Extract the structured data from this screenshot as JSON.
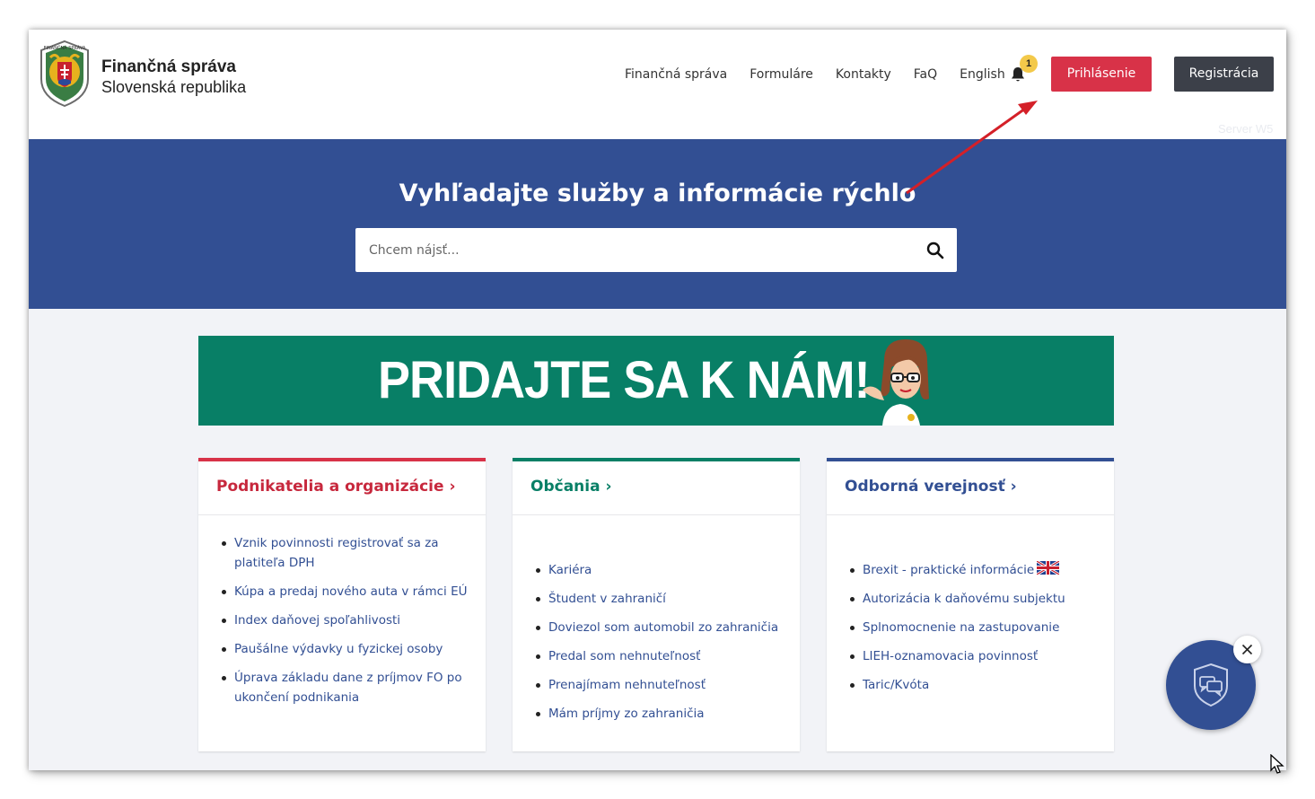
{
  "header": {
    "brand_line1": "Finančná správa",
    "brand_line2": "Slovenská republika",
    "nav": [
      {
        "label": "Finančná správa"
      },
      {
        "label": "Formuláre"
      },
      {
        "label": "Kontakty"
      },
      {
        "label": "FaQ"
      },
      {
        "label": "English"
      }
    ],
    "notifications_count": "1",
    "login_label": "Prihlásenie",
    "register_label": "Registrácia",
    "server_label": "Server W5"
  },
  "hero": {
    "title": "Vyhľadajte služby a informácie rýchlo",
    "search_placeholder": "Chcem nájsť..."
  },
  "banner": {
    "text": "PRIDAJTE SA K NÁM!"
  },
  "cards": [
    {
      "title": "Podnikatelia a organizácie ›",
      "color": "#d83248",
      "items": [
        "Vznik povinnosti registrovať sa za platiteľa DPH",
        "Kúpa a predaj nového auta v rámci EÚ",
        "Index daňovej spoľahlivosti",
        "Paušálne výdavky u fyzickej osoby",
        "Úprava základu dane z príjmov FO po ukončení podnikania"
      ]
    },
    {
      "title": "Občania ›",
      "color": "#087f66",
      "items": [
        "Kariéra",
        "Študent v zahraničí",
        "Doviezol som automobil zo zahraničia",
        "Predal som nehnuteľnosť",
        "Prenajímam nehnuteľnosť",
        "Mám príjmy zo zahraničia"
      ]
    },
    {
      "title": "Odborná verejnosť ›",
      "color": "#324f93",
      "items": [
        "Brexit - praktické informácie",
        "Autorizácia k daňovému subjektu",
        "Splnomocnenie na zastupovanie",
        "LIEH-oznamovacia povinnosť",
        "Taric/Kvóta"
      ]
    }
  ],
  "icons": {
    "bell": "bell-icon",
    "search": "search-icon",
    "chat": "chat-shield-icon",
    "close": "close-icon",
    "flag": "uk-flag-icon"
  }
}
